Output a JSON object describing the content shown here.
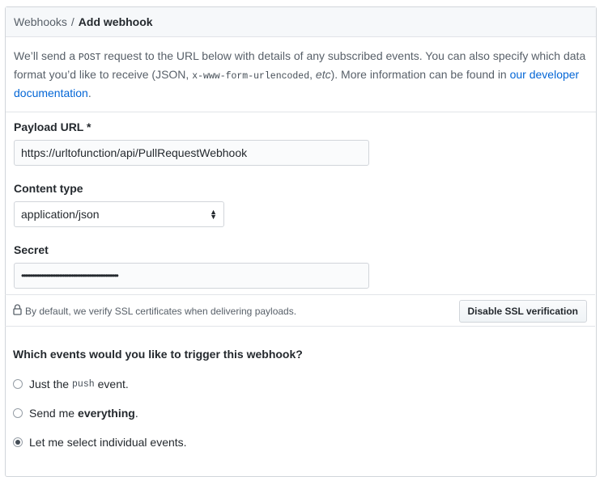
{
  "breadcrumb": {
    "parent": "Webhooks",
    "separator": "/",
    "current": "Add webhook"
  },
  "description": {
    "part1": "We’ll send a ",
    "method": "POST",
    "part2": " request to the URL below with details of any subscribed events. You can also specify which data format you’d like to receive (JSON, ",
    "format": "x-www-form-urlencoded",
    "part3": ", ",
    "etc": "etc",
    "part4": "). More information can be found in ",
    "link": "our developer documentation",
    "part5": "."
  },
  "form": {
    "payload_url_label": "Payload URL *",
    "payload_url_value": "https://urltofunction/api/PullRequestWebhook",
    "content_type_label": "Content type",
    "content_type_value": "application/json",
    "secret_label": "Secret",
    "secret_value": "••••••••••••••••••••••••••••••••••••••••••••••••••••••"
  },
  "ssl": {
    "text": "By default, we verify SSL certificates when delivering payloads.",
    "button": "Disable SSL verification"
  },
  "events": {
    "title": "Which events would you like to trigger this webhook?",
    "option1_prefix": "Just the",
    "option1_code": "push",
    "option1_suffix": "event.",
    "option2_prefix": "Send me",
    "option2_bold": "everything",
    "option2_suffix": ".",
    "option3": "Let me select individual events."
  }
}
